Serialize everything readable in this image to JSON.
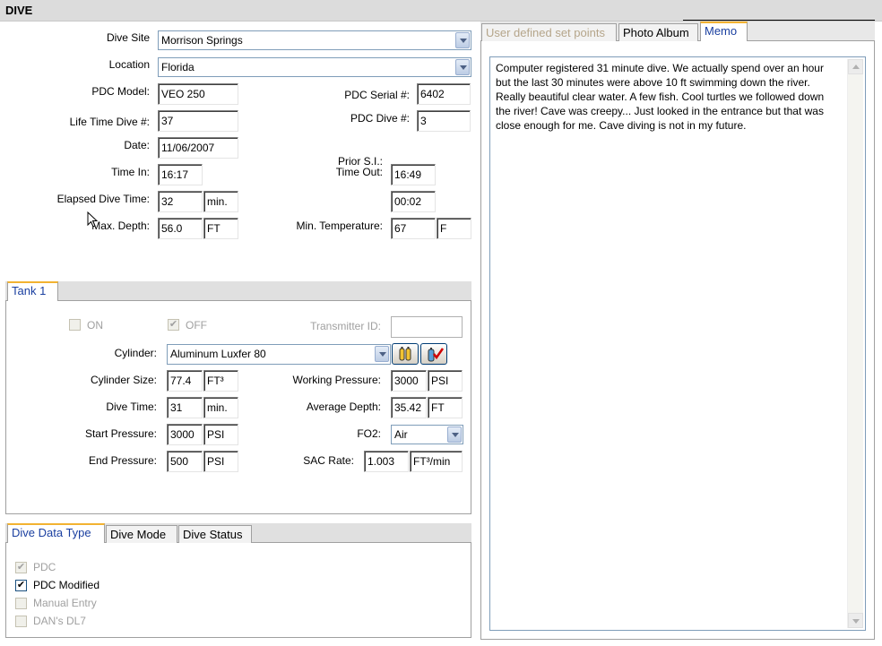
{
  "window": {
    "title": "DIVE"
  },
  "dive": {
    "site_label": "Dive Site",
    "site_value": "Morrison Springs",
    "location_label": "Location",
    "location_value": "Florida",
    "pdc_model_label": "PDC Model:",
    "pdc_model_value": "VEO 250",
    "pdc_serial_label": "PDC Serial #:",
    "pdc_serial_value": "6402",
    "lifetime_label": "Life Time Dive #:",
    "lifetime_value": "37",
    "pdc_dive_label": "PDC Dive #:",
    "pdc_dive_value": "3",
    "date_label": "Date:",
    "date_value": "11/06/2007",
    "time_in_label": "Time In:",
    "time_in_value": "16:17",
    "prior_si_label": "Prior S.I.:",
    "time_out_label": "Time Out:",
    "time_out_value": "16:49",
    "elapsed_label": "Elapsed Dive Time:",
    "elapsed_value": "32",
    "elapsed_unit": "min.",
    "prior_si_value": "00:02",
    "max_depth_label": "Max. Depth:",
    "max_depth_value": "56.0",
    "max_depth_unit": "FT",
    "min_temp_label": "Min. Temperature:",
    "min_temp_value": "67",
    "min_temp_unit": "F"
  },
  "tank": {
    "tab_label": "Tank 1",
    "on_label": "ON",
    "on_checked": false,
    "off_label": "OFF",
    "off_checked": true,
    "transmitter_label": "Transmitter ID:",
    "transmitter_value": "",
    "cylinder_label": "Cylinder:",
    "cylinder_value": "Aluminum Luxfer 80",
    "cyl_size_label": "Cylinder Size:",
    "cyl_size_value": "77.4",
    "cyl_size_unit": "FT³",
    "working_pressure_label": "Working Pressure:",
    "working_pressure_value": "3000",
    "working_pressure_unit": "PSI",
    "dive_time_label": "Dive Time:",
    "dive_time_value": "31",
    "dive_time_unit": "min.",
    "avg_depth_label": "Average Depth:",
    "avg_depth_value": "35.42",
    "avg_depth_unit": "FT",
    "start_pressure_label": "Start Pressure:",
    "start_pressure_value": "3000",
    "start_pressure_unit": "PSI",
    "fo2_label": "FO2:",
    "fo2_value": "Air",
    "end_pressure_label": "End Pressure:",
    "end_pressure_value": "500",
    "end_pressure_unit": "PSI",
    "sac_label": "SAC Rate:",
    "sac_value": "1.003",
    "sac_unit": "FT³/min"
  },
  "bottom_tabs": {
    "tab1": "Dive Data Type",
    "tab2": "Dive Mode",
    "tab3": "Dive Status",
    "items": [
      {
        "label": "PDC",
        "checked": true,
        "disabled": true
      },
      {
        "label": "PDC Modified",
        "checked": true,
        "disabled": false
      },
      {
        "label": "Manual Entry",
        "checked": false,
        "disabled": true
      },
      {
        "label": "DAN's DL7",
        "checked": false,
        "disabled": true
      }
    ]
  },
  "right_tabs": {
    "tab1": "User defined set points",
    "tab2": "Photo Album",
    "tab3": "Memo"
  },
  "memo": {
    "text": "Computer registered 31 minute dive. We actually spend over an hour but the last 30 minutes were above 10 ft swimming down the river. Really beautiful clear water. A few fish. Cool turtles we followed down the river! Cave was creepy... Just looked in the entrance but that was close enough for me. Cave diving is not in my future."
  },
  "icons": {
    "cylinder_pick": "cylinder-library-icon",
    "cylinder_edit": "cylinder-edit-icon"
  }
}
